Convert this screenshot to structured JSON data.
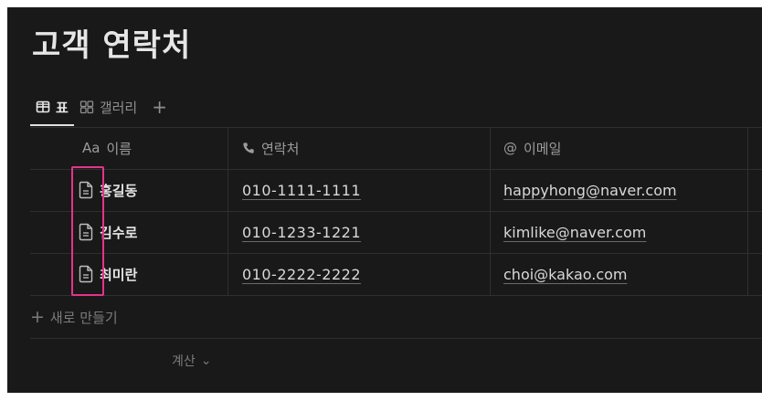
{
  "page": {
    "title": "고객 연락처"
  },
  "tabs": [
    {
      "label": "표",
      "icon": "table-icon",
      "active": true
    },
    {
      "label": "갤러리",
      "icon": "gallery-icon",
      "active": false
    }
  ],
  "add_view_label": "+",
  "columns": [
    {
      "prefix": "Aa",
      "label": "이름"
    },
    {
      "icon": "phone-icon",
      "label": "연락처"
    },
    {
      "prefix": "@",
      "label": "이메일"
    }
  ],
  "rows": [
    {
      "name": "홍길동",
      "phone": "010-1111-1111",
      "email": "happyhong@naver.com"
    },
    {
      "name": "김수로",
      "phone": "010-1233-1221",
      "email": "kimlike@naver.com"
    },
    {
      "name": "최미란",
      "phone": "010-2222-2222",
      "email": "choi@kakao.com"
    }
  ],
  "new_row": {
    "plus": "+",
    "label": "새로 만들기"
  },
  "calculate": {
    "label": "계산",
    "chevron": "⌄"
  },
  "colors": {
    "background": "#191919",
    "highlight": "#e5338b"
  }
}
